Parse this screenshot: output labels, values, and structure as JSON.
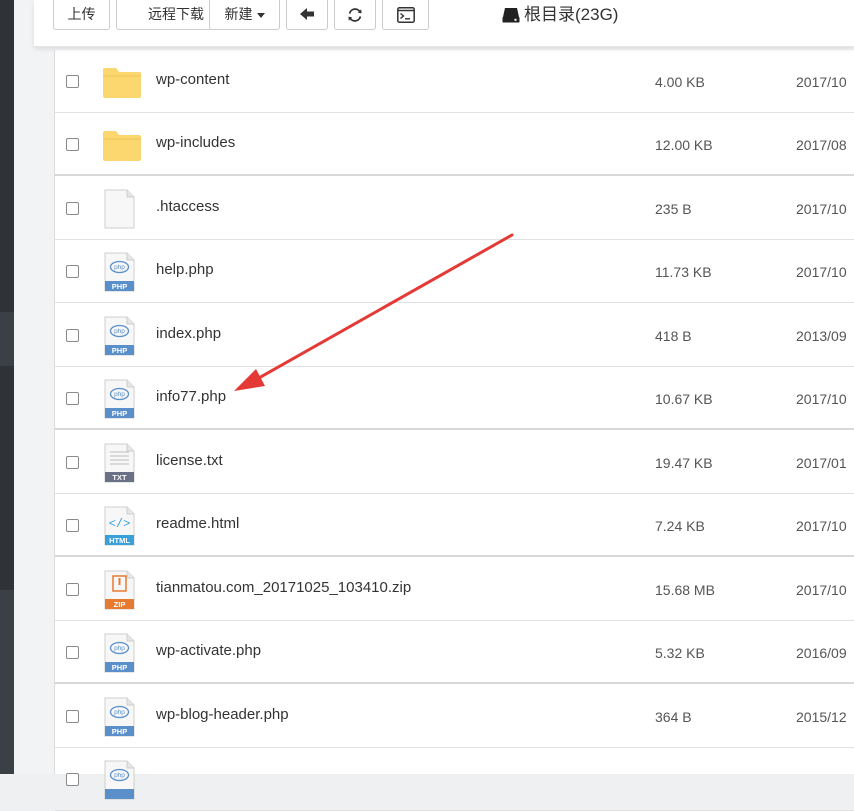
{
  "toolbar": {
    "upload_label": "上传",
    "remote_download_label": "远程下载",
    "new_label": "新建",
    "back_icon": "arrow-left-icon",
    "refresh_icon": "refresh-icon",
    "terminal_icon": "terminal-icon",
    "root_label": "根目录(23G)"
  },
  "colors": {
    "folder": "#fcd66f",
    "php_badge": "#5b8fc9",
    "txt_badge": "#6a7186",
    "html_badge": "#3aa0d9",
    "zip_badge": "#e57a30",
    "annotation_arrow": "#e53935"
  },
  "files": [
    {
      "name": "wp-content",
      "size": "4.00 KB",
      "date": "2017/10",
      "type": "folder"
    },
    {
      "name": "wp-includes",
      "size": "12.00 KB",
      "date": "2017/08",
      "type": "folder"
    },
    {
      "name": ".htaccess",
      "size": "235 B",
      "date": "2017/10",
      "type": "blank"
    },
    {
      "name": "help.php",
      "size": "11.73 KB",
      "date": "2017/10",
      "type": "php",
      "badge": "PHP"
    },
    {
      "name": "index.php",
      "size": "418 B",
      "date": "2013/09",
      "type": "php",
      "badge": "PHP"
    },
    {
      "name": "info77.php",
      "size": "10.67 KB",
      "date": "2017/10",
      "type": "php",
      "badge": "PHP"
    },
    {
      "name": "license.txt",
      "size": "19.47 KB",
      "date": "2017/01",
      "type": "txt",
      "badge": "TXT"
    },
    {
      "name": "readme.html",
      "size": "7.24 KB",
      "date": "2017/10",
      "type": "html",
      "badge": "HTML"
    },
    {
      "name": "tianmatou.com_20171025_103410.zip",
      "size": "15.68 MB",
      "date": "2017/10",
      "type": "zip",
      "badge": "ZIP"
    },
    {
      "name": "wp-activate.php",
      "size": "5.32 KB",
      "date": "2016/09",
      "type": "php",
      "badge": "PHP"
    },
    {
      "name": "wp-blog-header.php",
      "size": "364 B",
      "date": "2015/12",
      "type": "php",
      "badge": "PHP"
    },
    {
      "name": "",
      "size": "",
      "date": "",
      "type": "php",
      "badge": ""
    }
  ]
}
